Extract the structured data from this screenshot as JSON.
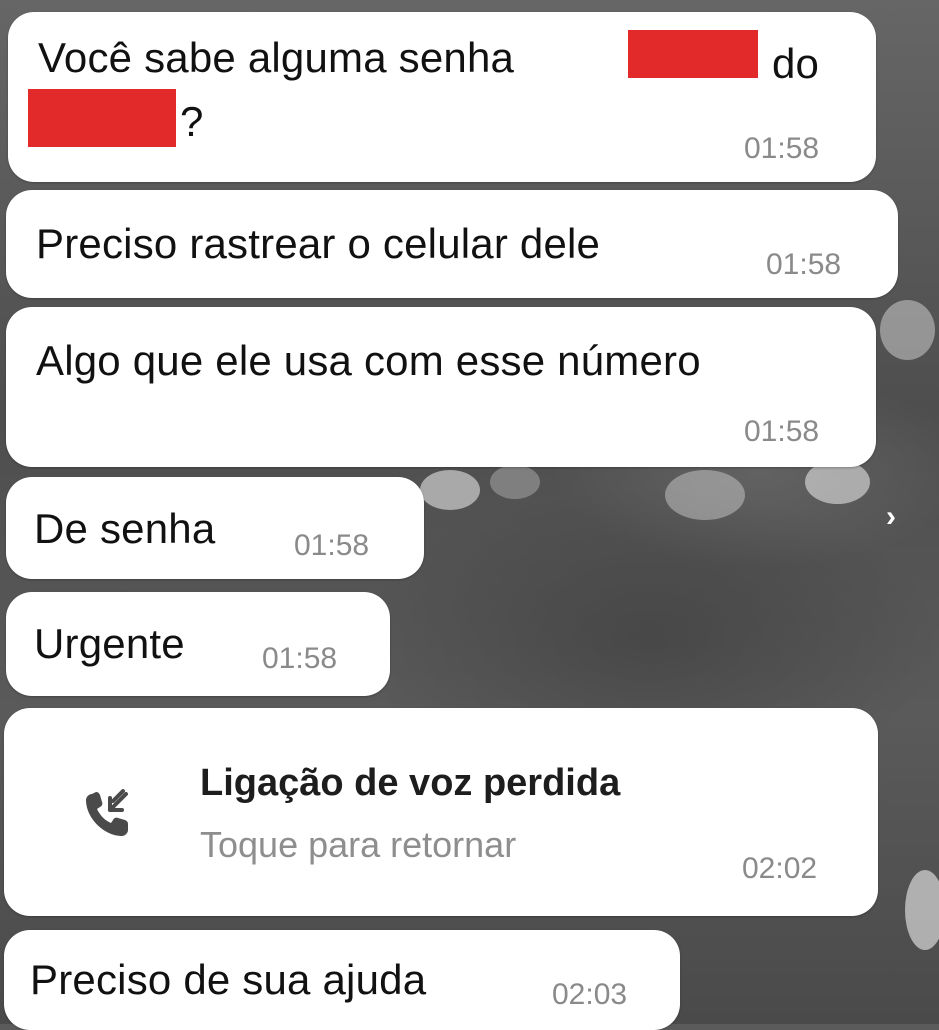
{
  "messages": [
    {
      "line1_a": "Você sabe alguma senha",
      "line1_b": "do",
      "line2_b": "?",
      "time": "01:58"
    },
    {
      "text": "Preciso rastrear o celular dele",
      "time": "01:58"
    },
    {
      "text": "Algo que ele usa com esse número",
      "time": "01:58"
    },
    {
      "text": "De senha",
      "time": "01:58"
    },
    {
      "text": "Urgente",
      "time": "01:58"
    },
    {
      "title": "Ligação de voz perdida",
      "subtitle": "Toque para retornar",
      "time": "02:02",
      "icon": "missed-call-icon"
    },
    {
      "text": "Preciso de sua ajuda",
      "time": "02:03"
    }
  ],
  "nav": {
    "next_glyph": "›"
  },
  "colors": {
    "bubble": "#ffffff",
    "redaction": "#e32a2a",
    "time": "#8a8a8a"
  }
}
